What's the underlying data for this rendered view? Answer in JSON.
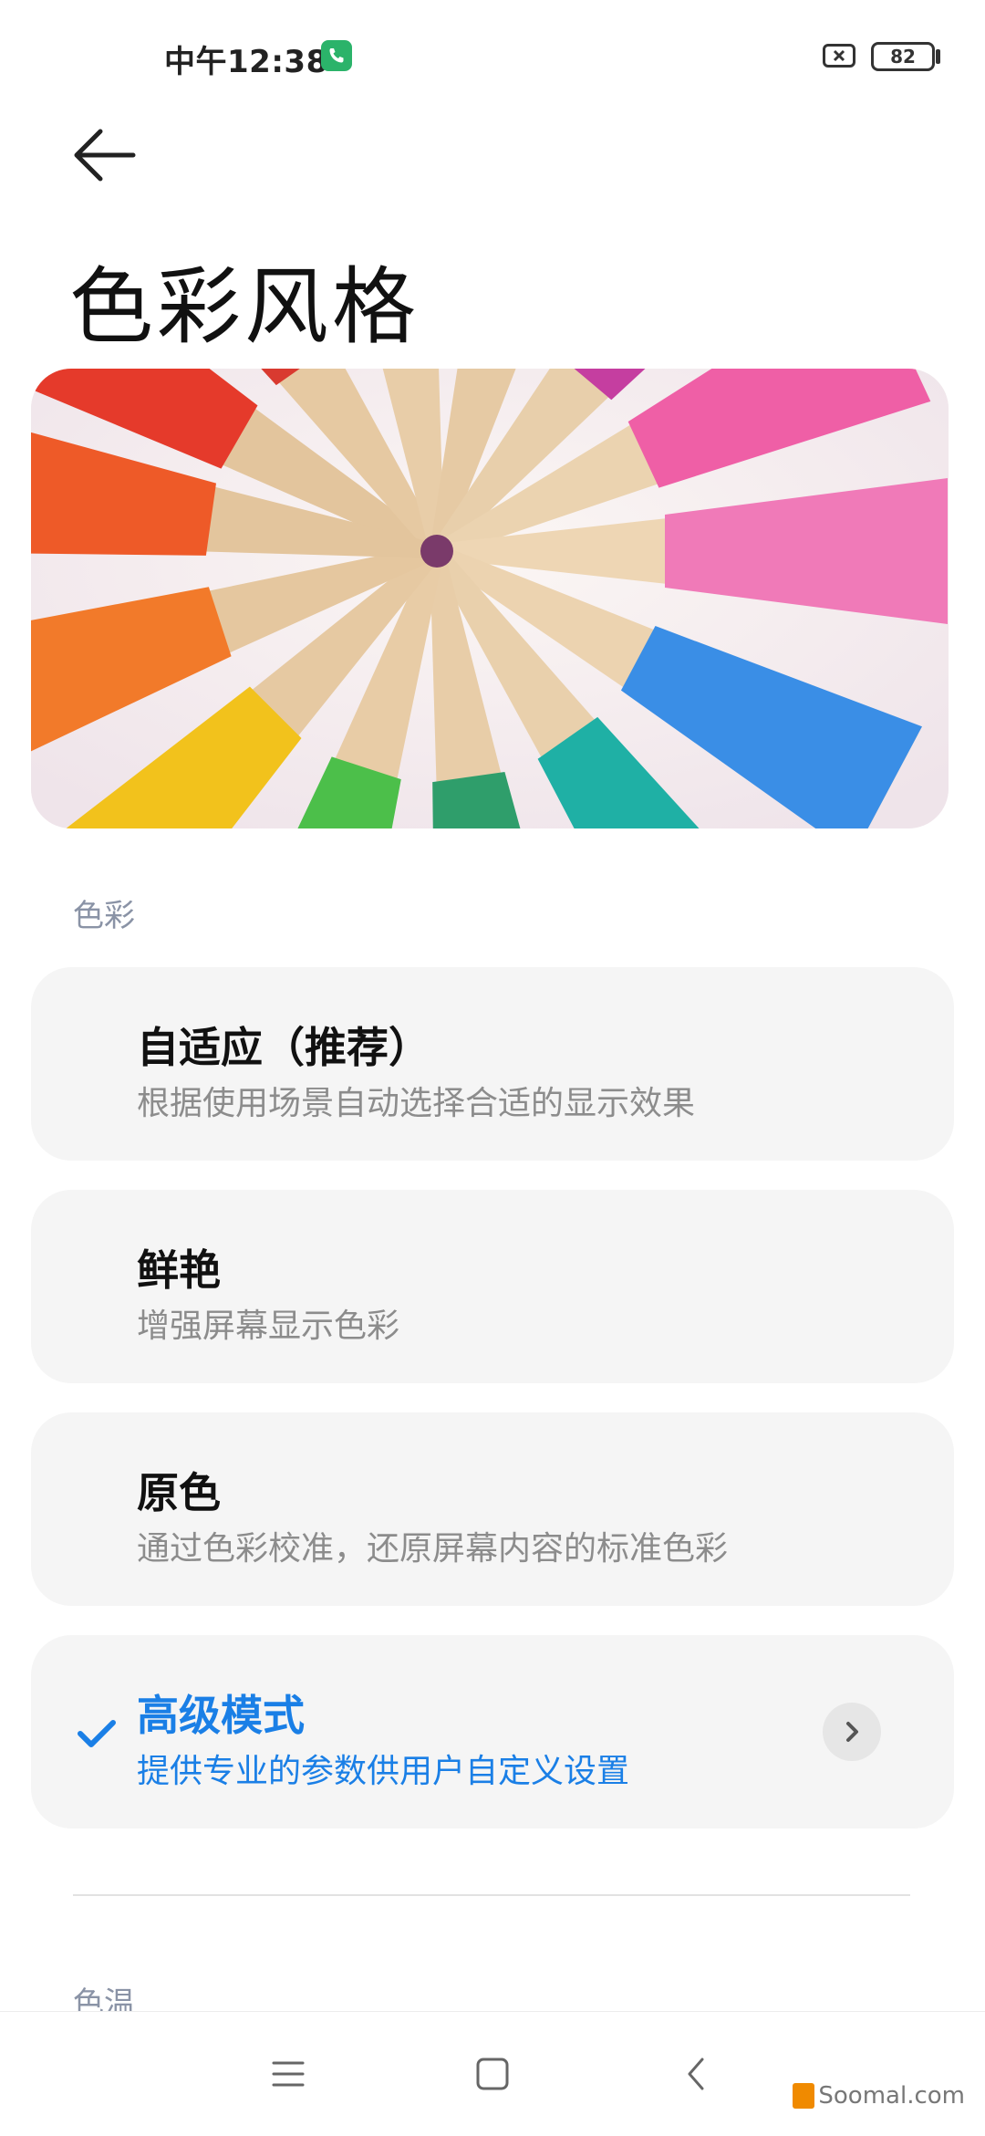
{
  "status_bar": {
    "time": "中午12:38",
    "battery": "82",
    "icons": [
      "call-icon",
      "battery-x-icon",
      "battery-icon"
    ]
  },
  "header": {
    "back_icon": "back-arrow-icon",
    "title": "色彩风格"
  },
  "banner": {
    "icon": "colored-pencils-image"
  },
  "color_section": {
    "label": "色彩",
    "options": [
      {
        "title": "自适应（推荐）",
        "desc": "根据使用场景自动选择合适的显示效果",
        "selected": false
      },
      {
        "title": "鲜艳",
        "desc": "增强屏幕显示色彩",
        "selected": false
      },
      {
        "title": "原色",
        "desc": "通过色彩校准，还原屏幕内容的标准色彩",
        "selected": false
      },
      {
        "title": "高级模式",
        "desc": "提供专业的参数供用户自定义设置",
        "selected": true
      }
    ]
  },
  "temperature_section": {
    "label": "色温"
  },
  "nav_bar": {
    "icons": [
      "menu-icon",
      "home-icon",
      "back-icon"
    ]
  },
  "watermark": {
    "text": "Soomal.com"
  },
  "colors": {
    "accent": "#1a7fe6",
    "card_bg": "#f5f5f5",
    "section_label": "#8a93a6"
  }
}
